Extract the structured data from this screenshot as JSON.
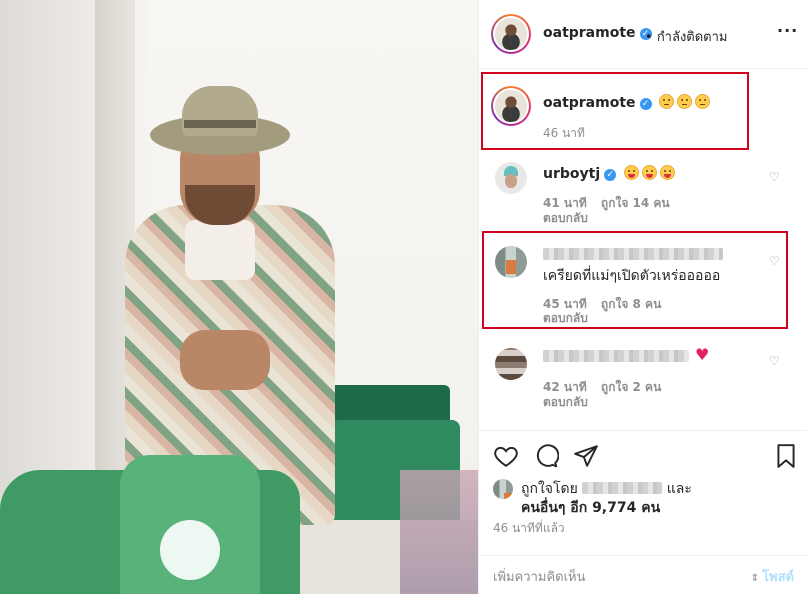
{
  "header": {
    "username": "oatpramote",
    "separator": "•",
    "follow_status": "กำลังติดตาม",
    "more_icon": "more-icon"
  },
  "caption": {
    "username": "oatpramote",
    "emojis": [
      "neutral-face-emoji",
      "neutral-face-emoji",
      "neutral-face-emoji"
    ],
    "time": "46 นาที"
  },
  "comments": [
    {
      "username": "urboytj",
      "verified": true,
      "emojis": [
        "tongue-emoji",
        "tongue-emoji",
        "tongue-emoji"
      ],
      "time": "41 นาที",
      "likes": "ถูกใจ 14 คน",
      "reply": "ตอบกลับ"
    },
    {
      "username_blurred": true,
      "text": "เครียดที่แม่ๆเปิดตัวเหร่อออออ",
      "time": "45 นาที",
      "likes": "ถูกใจ 8 คน",
      "reply": "ตอบกลับ"
    },
    {
      "username_blurred": true,
      "emoji": "red-heart",
      "time": "42 นาที",
      "likes": "ถูกใจ 2 คน",
      "reply": "ตอบกลับ"
    }
  ],
  "actions": {
    "liked_by_prefix": "ถูกใจโดย",
    "liked_by_and": "และ",
    "others_text": "คนอื่นๆ อีก 9,774 คน",
    "posted_ago": "46 นาทีที่แล้ว"
  },
  "add_comment": {
    "placeholder": "เพิ่มความคิดเห็น",
    "post_label": "โพสต์"
  },
  "colors": {
    "verified": "#3897f0",
    "highlight_box": "#d0021b",
    "heart": "#e0245e",
    "post_button": "#b2dffc"
  }
}
